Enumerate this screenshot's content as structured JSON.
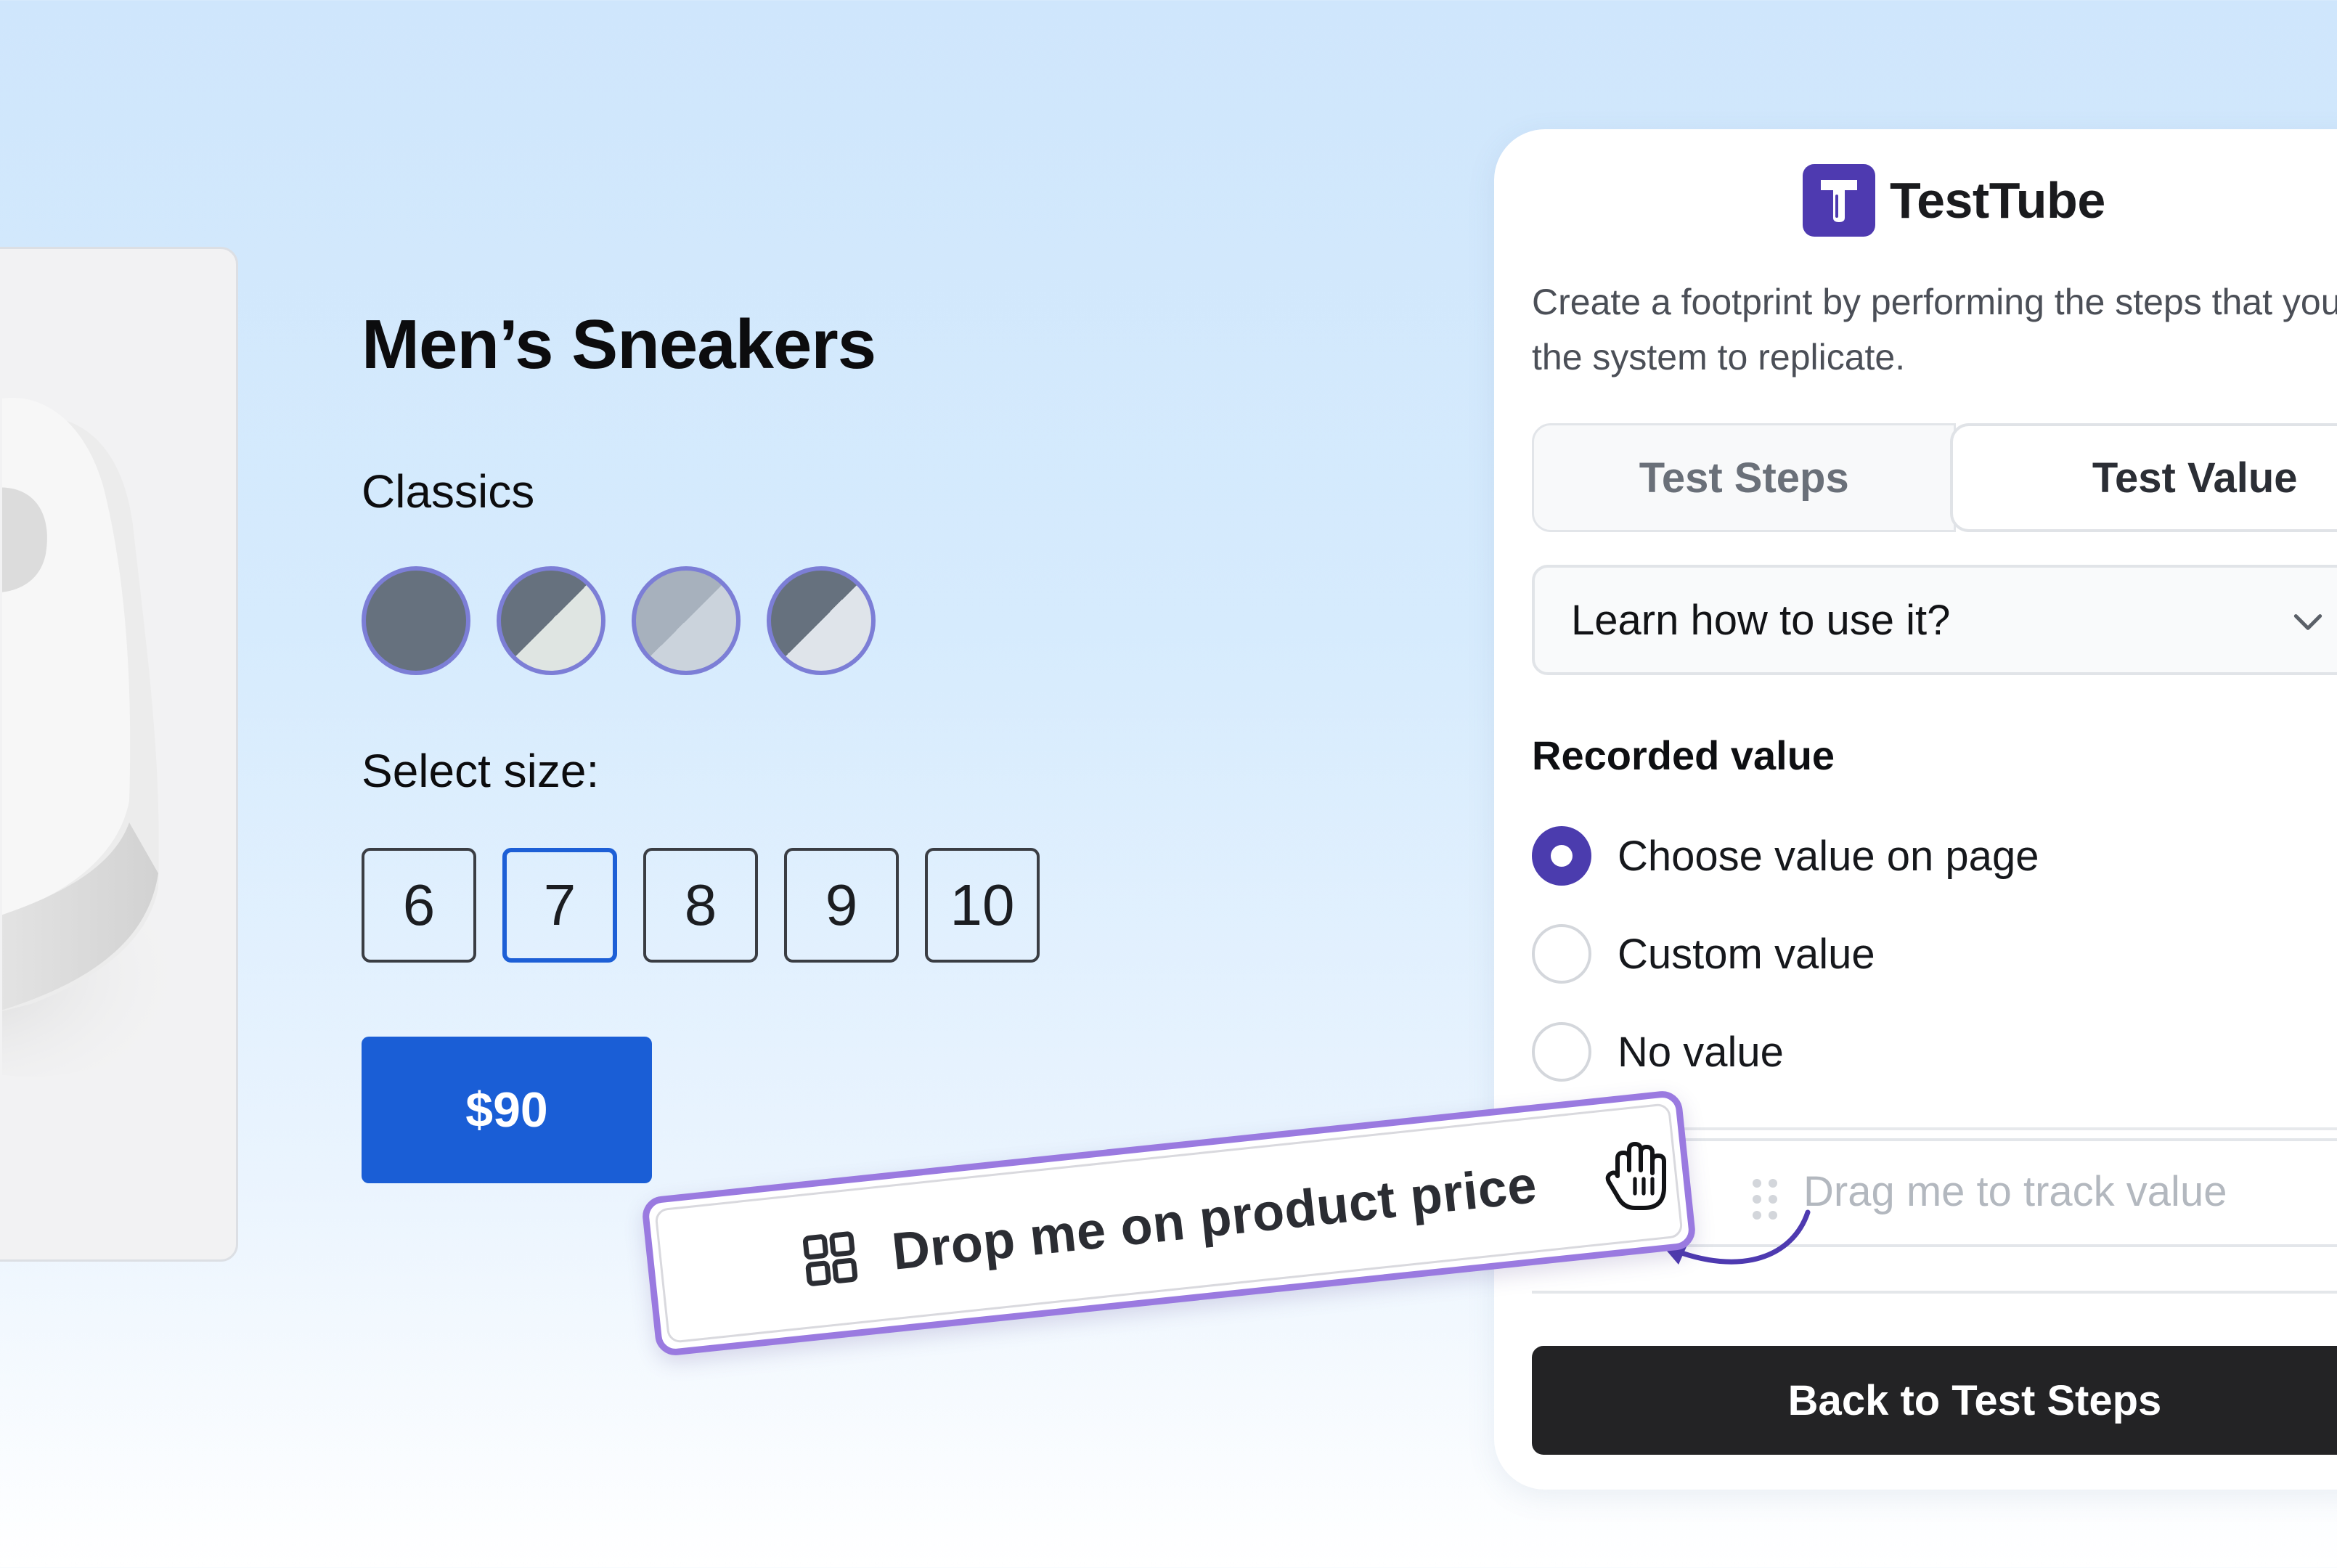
{
  "product": {
    "title": "Men’s Sneakers",
    "collection": "Classics",
    "swatch_colors": [
      "#66717e",
      "#66717e/#dfe5e2",
      "#a7b1bd/#cbd3dc",
      "#66717e/#dfe4ea"
    ],
    "size_label": "Select size:",
    "sizes": [
      "6",
      "7",
      "8",
      "9",
      "10"
    ],
    "selected_size": "7",
    "price": "$90",
    "gallery_prev_icon": "chevron-left-icon",
    "gallery_next_icon": "chevron-right-icon"
  },
  "panel": {
    "app_name": "TestTube",
    "description": "Create a footprint by performing the steps that you want the system to replicate.",
    "tabs": [
      "Test Steps",
      "Test Value"
    ],
    "active_tab": "Test Value",
    "help_accordion": "Learn how to use it?",
    "recorded_value": {
      "title": "Recorded value",
      "options": [
        "Choose value on page",
        "Custom value",
        "No value"
      ],
      "selected": "Choose value on page"
    },
    "drag_placeholder": "Drag me to track value",
    "back_button": "Back to Test Steps"
  },
  "drag_chip": {
    "label": "Drop me on product price",
    "icon": "grid-icon"
  },
  "colors": {
    "accent_purple": "#4e3ab0",
    "price_blue": "#1a5ed6",
    "chip_border": "#9a7ae0",
    "swatch_border": "#7c7ed6"
  }
}
